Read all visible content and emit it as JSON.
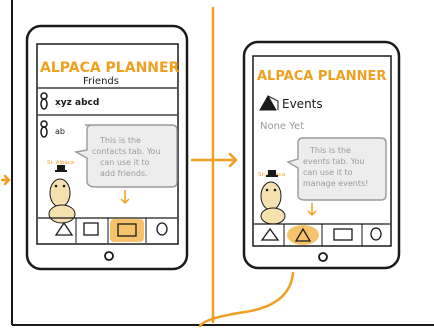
{
  "colors": {
    "ink": "#1a1a1a",
    "orange": "#f0a020",
    "gray_text": "#9a9a9a",
    "bubble_fill": "#ededed",
    "bubble_stroke": "#9a9a9a",
    "highlight": "#f6c36a"
  },
  "icons": {
    "person": "person-icon",
    "tent": "tent-icon",
    "photos": "photos-icon",
    "alpaca": "alpaca-mascot-icon"
  },
  "left_phone": {
    "app_title": "ALPACA PLANNER",
    "page_title": "Friends",
    "friend_1": "xyz abcd",
    "friend_2_partial": "ab",
    "mascot_label": "Sr. Alpaca",
    "bubble_lines": [
      "This is the",
      "contacts tab. You",
      "can use it to",
      "add friends."
    ],
    "active_tab": 2
  },
  "right_phone": {
    "app_title": "ALPACA PLANNER",
    "page_title": "Events",
    "empty_state": "None Yet",
    "mascot_label": "Sr. Alpaca",
    "bubble_lines": [
      "This is the",
      "events tab. You",
      "can use it to",
      "manage events!"
    ],
    "active_tab": 1
  }
}
